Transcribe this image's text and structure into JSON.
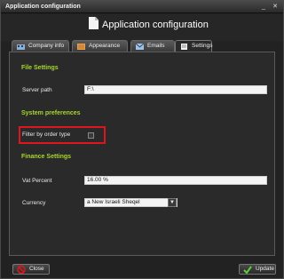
{
  "window": {
    "title": "Application configuration",
    "minimize_icon": "minimize-icon",
    "close_icon": "close-icon"
  },
  "header": {
    "title": "Application configuration",
    "icon": "document-icon"
  },
  "tabs": [
    {
      "label": "Company info",
      "icon": "company-icon",
      "active": false
    },
    {
      "label": "Appearance",
      "icon": "appearance-icon",
      "active": false
    },
    {
      "label": "Emails",
      "icon": "email-icon",
      "active": false
    },
    {
      "label": "Settings",
      "icon": "settings-icon",
      "active": true
    }
  ],
  "file_settings": {
    "heading": "File Settings",
    "server_path_label": "Server path",
    "server_path_value": "F:\\"
  },
  "system_preferences": {
    "heading": "System preferences",
    "filter_label": "Filter by order type",
    "filter_checked": false
  },
  "finance_settings": {
    "heading": "Finance Settings",
    "vat_label": "Vat Percent",
    "vat_value": "16.00 %",
    "currency_label": "Currency",
    "currency_value": "a New Israeli Sheqel"
  },
  "footer": {
    "close_label": "Close",
    "update_label": "Update"
  },
  "colors": {
    "section_heading": "#a6d62a",
    "highlight_border": "#e0141c",
    "panel_bg": "#2a2a2a"
  }
}
